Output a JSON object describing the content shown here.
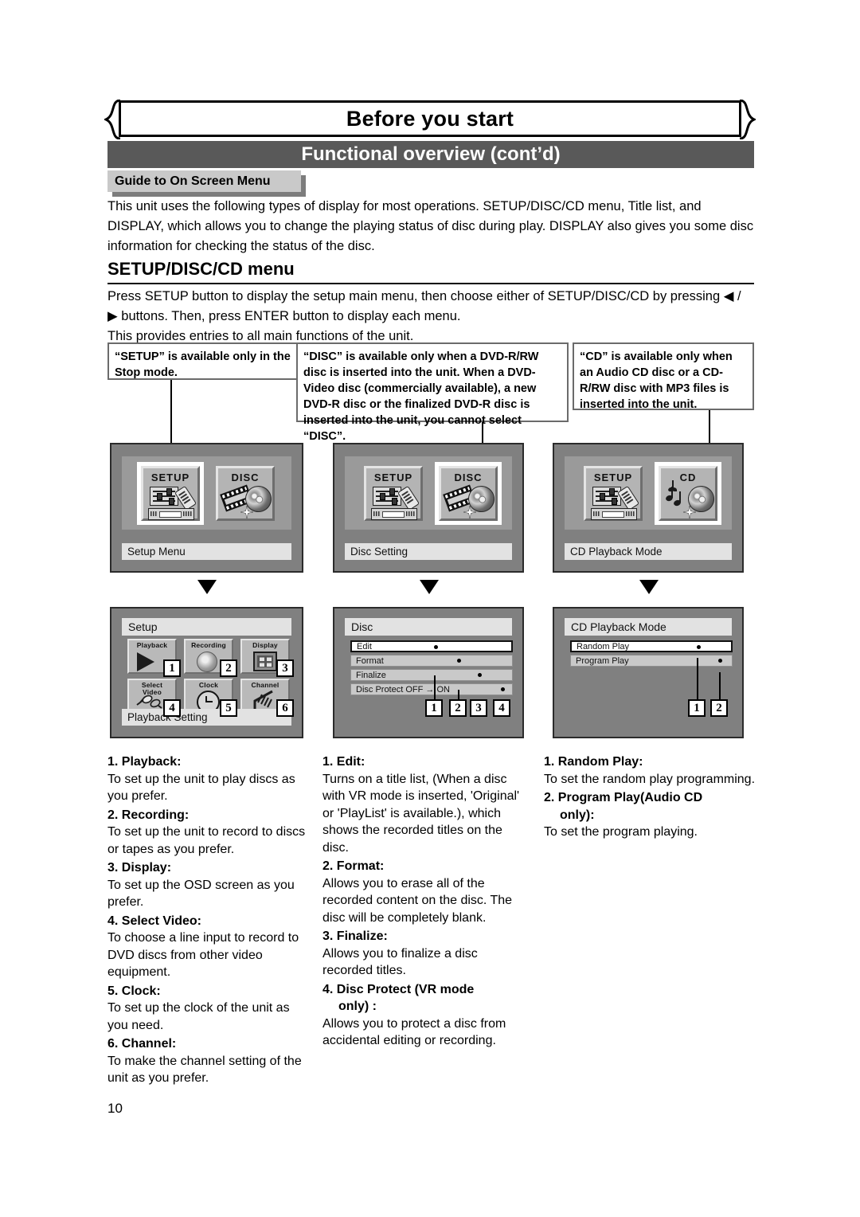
{
  "header": {
    "title": "Before you start",
    "subtitle": "Functional overview (cont’d)",
    "section_tab": "Guide to On Screen Menu"
  },
  "intro_paragraph": "This unit uses the following types of display for most operations. SETUP/DISC/CD menu, Title list, and DISPLAY, which allows you to change the playing status of disc during play. DISPLAY also gives you some disc information for checking the status of the disc.",
  "setup_menu_heading": "SETUP/DISC/CD menu",
  "setup_paragraph_1": "Press SETUP button to display the setup main menu, then choose either of SETUP/DISC/CD by pressing ◀ / ▶ buttons. Then, press ENTER button to display each menu.",
  "setup_paragraph_2": "This provides entries to all main functions of the unit.",
  "callouts": {
    "setup": "“SETUP” is available only in the Stop mode.",
    "disc": "“DISC” is available only when a DVD-R/RW disc is inserted into the unit. When a DVD-Video disc (commercially available), a new DVD-R disc or the finalized DVD-R disc is inserted into the unit, you cannot select “DISC”.",
    "cd": "“CD” is available only when an Audio CD disc or a CD-R/RW disc with MP3 files is inserted into the unit."
  },
  "screens_top": [
    {
      "tile_left": "SETUP",
      "tile_right": "DISC",
      "selected": "left",
      "caption": "Setup Menu"
    },
    {
      "tile_left": "SETUP",
      "tile_right": "DISC",
      "selected": "right",
      "caption": "Disc Setting"
    },
    {
      "tile_left": "SETUP",
      "tile_right": "CD",
      "selected": "right",
      "caption": "CD Playback Mode"
    }
  ],
  "setup_screen": {
    "title": "Setup",
    "caption": "Playback Setting",
    "tiles": [
      {
        "label": "Playback",
        "number": "1",
        "icon": "play-icon"
      },
      {
        "label": "Recording",
        "number": "2",
        "icon": "record-icon"
      },
      {
        "label": "Display",
        "number": "3",
        "icon": "display-icon"
      },
      {
        "label": "Select\nVideo",
        "number": "4",
        "icon": "av-plug-icon"
      },
      {
        "label": "Clock",
        "number": "5",
        "icon": "clock-icon"
      },
      {
        "label": "Channel",
        "number": "6",
        "icon": "antenna-icon"
      }
    ]
  },
  "disc_screen": {
    "title": "Disc",
    "rows": [
      {
        "label": "Edit",
        "number": "1",
        "highlighted": true
      },
      {
        "label": "Format",
        "number": "2",
        "highlighted": false
      },
      {
        "label": "Finalize",
        "number": "3",
        "highlighted": false
      },
      {
        "label": "Disc Protect OFF → ON",
        "number": "4",
        "highlighted": false
      }
    ]
  },
  "cd_screen": {
    "title": "CD Playback Mode",
    "rows": [
      {
        "label": "Random Play",
        "number": "1",
        "highlighted": true
      },
      {
        "label": "Program Play",
        "number": "2",
        "highlighted": false
      }
    ]
  },
  "descriptions": {
    "setup": [
      {
        "heading": "1. Playback:",
        "body": "To set up the unit to play discs as you prefer."
      },
      {
        "heading": "2. Recording:",
        "body": "To set up the unit to record to discs or tapes as you prefer."
      },
      {
        "heading": "3. Display:",
        "body": "To set up the OSD screen as you prefer."
      },
      {
        "heading": "4. Select Video:",
        "body": "To choose a line input to record to DVD discs from other video equipment."
      },
      {
        "heading": "5. Clock:",
        "body": "To set up the clock of the unit as you need."
      },
      {
        "heading": "6. Channel:",
        "body": "To make the channel setting of the unit as you prefer."
      }
    ],
    "disc": [
      {
        "heading": "1. Edit:",
        "body": "Turns on a title list, (When a disc with VR mode is inserted, 'Original' or 'PlayList' is available.), which shows the recorded titles on the disc."
      },
      {
        "heading": "2. Format:",
        "body": "Allows you to erase all of the recorded content on the disc. The disc will be completely blank."
      },
      {
        "heading": "3. Finalize:",
        "body": "Allows you to finalize a disc recorded titles."
      },
      {
        "heading": "4. Disc Protect (VR mode",
        "heading2": "only) :",
        "body": "Allows you to protect a disc from accidental editing or recording."
      }
    ],
    "cd": [
      {
        "heading": "1. Random Play:",
        "body": "To set the random play programming."
      },
      {
        "heading": "2. Program Play(Audio CD",
        "heading2": "only):",
        "body": "To set the program playing."
      }
    ]
  },
  "page_number": "10",
  "colors": {
    "subbar": "#595959",
    "screen_bg": "#808080",
    "stage_bg": "#9a9a9a",
    "caption_bg": "#e2e2e2",
    "tab_bg": "#c9c9c9"
  }
}
